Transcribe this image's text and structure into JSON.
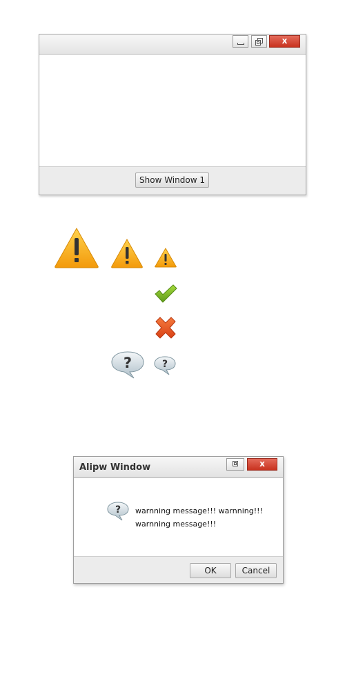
{
  "window1": {
    "title": "",
    "footer_button": "Show Window 1",
    "controls": {
      "minimize_icon": "minimize-icon",
      "restore_icon": "restore-icon",
      "close_label": "x"
    }
  },
  "icon_gallery": {
    "warning_icons": [
      "warning-large-icon",
      "warning-medium-icon",
      "warning-small-icon"
    ],
    "check_icon": "check-icon",
    "error_icon": "error-x-icon",
    "question_icons": [
      "question-large-icon",
      "question-small-icon"
    ],
    "colors": {
      "warning": "#f7a81b",
      "check": "#78b52a",
      "error": "#e5542a",
      "question": "#c9d6dd"
    }
  },
  "dialog": {
    "title": "Alipw Window",
    "message": "warnning message!!! warnning!!! warnning message!!!",
    "ok_label": "OK",
    "cancel_label": "Cancel",
    "close_label": "x"
  }
}
